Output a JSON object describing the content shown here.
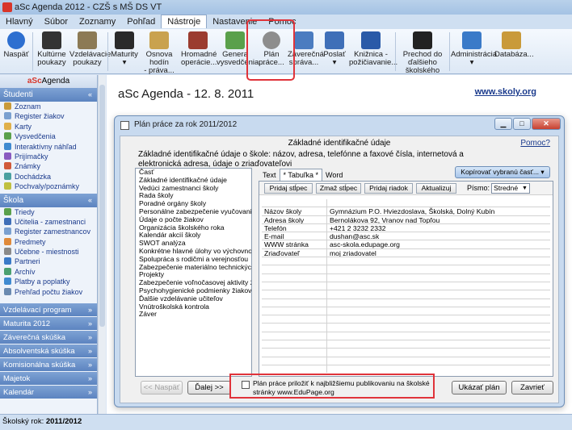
{
  "window": {
    "title": "aSc Agenda 2012 - CZŠ s MŠ DS VT"
  },
  "menu": {
    "items": [
      "Hlavný",
      "Súbor",
      "Zoznamy",
      "Pohľad",
      "Nástroje",
      "Nastavenie",
      "Pomoc"
    ],
    "active": "Nástroje"
  },
  "ribbon": {
    "buttons": [
      {
        "label1": "Naspäť",
        "label2": "",
        "icon": "back-arrow-icon",
        "color": "#2d6fd0"
      },
      {
        "label1": "Kultúrne",
        "label2": "poukazy",
        "icon": "piano-icon",
        "color": "#333333"
      },
      {
        "label1": "Vzdelávacie",
        "label2": "poukazy",
        "icon": "voucher-icon",
        "color": "#8c7a55"
      },
      {
        "label1": "Maturity",
        "label2": "",
        "icon": "graduation-icon",
        "color": "#2a2a2a"
      },
      {
        "label1": "Osnova hodín",
        "label2": "- práva...",
        "icon": "calendar-icon",
        "color": "#c9a24e"
      },
      {
        "label1": "Hromadné",
        "label2": "operácie...",
        "icon": "books-icon",
        "color": "#9b3c2f"
      },
      {
        "label1": "Genera",
        "label2": "vysvedčenia...",
        "icon": "certificate-icon",
        "color": "#5aa04b"
      },
      {
        "label1": "Plán",
        "label2": "práce...",
        "icon": "stopwatch-icon",
        "color": "#8d8d8d"
      },
      {
        "label1": "Záverečná",
        "label2": "správa...",
        "icon": "chart-icon",
        "color": "#4b7cc0"
      },
      {
        "label1": "Poslať",
        "label2": "",
        "icon": "people-icon",
        "color": "#3f6fb8"
      },
      {
        "label1": "Knižnica -",
        "label2": "požičiavanie...",
        "icon": "book-icon",
        "color": "#2a5aa8"
      },
      {
        "label1": "Prechod do",
        "label2": "ďalšieho",
        "label3": "školského roku...",
        "icon": "flag-icon",
        "color": "#222222"
      },
      {
        "label1": "Administrácia",
        "label2": "",
        "icon": "admin-icon",
        "color": "#3a7ac8"
      },
      {
        "label1": "Databáza...",
        "label2": "",
        "icon": "database-icon",
        "color": "#c99a3a"
      }
    ]
  },
  "sidebar": {
    "logo_a": "aSc",
    "logo_b": "Agenda",
    "studenti": {
      "title": "Študenti",
      "items": [
        "Zoznam",
        "Register žiakov",
        "Karty",
        "Vysvedčenia",
        "Interaktívny náhľad",
        "Prijímačky",
        "Známky",
        "Dochádzka",
        "Pochvaly/poznámky"
      ]
    },
    "skola": {
      "title": "Škola",
      "items": [
        "Triedy",
        "Učitelia - zamestnanci",
        "Register zamestnancov",
        "Predmety",
        "Učebne - miestnosti",
        "Partneri",
        "Archív",
        "Platby a poplatky",
        "Prehľad počtu žiakov"
      ]
    },
    "collapsed": [
      "Vzdelávací program",
      "Maturita 2012",
      "Záverečná skúška",
      "Absolventská skúška",
      "Komisionálna skúška",
      "Majetok",
      "Kalendár"
    ]
  },
  "main": {
    "heading": "aSc Agenda - 12. 8. 2011",
    "site_link": "www.skoly.org"
  },
  "status": {
    "label": "Školský rok:",
    "value": "2011/2012"
  },
  "dialog": {
    "title": "Plán práce za rok 2011/2012",
    "heading": "Základné identifikačné údaje",
    "help": "Pomoc?",
    "description": "Základné identifikačné údaje o škole: názov, adresa, telefónne a faxové čísla, internetová a elektronická adresa, údaje o zriaďovateľovi",
    "list_items": [
      "Časť",
      "Základné identifikačné údaje",
      "Vedúci zamestnanci školy",
      "Rada školy",
      "Poradné orgány školy",
      "Personálne zabezpečenie vyučovania",
      "Údaje o počte žiakov",
      "Organizácia školského roka",
      "Kalendár akcií školy",
      "SWOT analýza",
      "Konkrétne hlavné úlohy vo výchovno – vzde",
      "Spolupráca s rodičmi a verejnosťou",
      "Zabezpečenie materiálno technických podm",
      "Projekty",
      "Zabezpečenie voľnočasovej aktivity žiakov",
      "Psychohygienické podmienky žiakov a učite",
      "Ďalšie vzdelávanie učiteľov",
      "Vnútroškolská kontrola",
      "Záver"
    ],
    "tabs": [
      "Text",
      "* Tabuľka *",
      "Word"
    ],
    "copy_button": "Kopírovať vybranú časť...",
    "table_buttons": [
      "Pridaj stĺpec",
      "Zmaž stĺpec",
      "Pridaj riadok",
      "Aktualizuj"
    ],
    "font_label": "Písmo:",
    "font_value": "Stredné",
    "rows": [
      [
        "",
        ""
      ],
      [
        "Názov školy",
        "Gymnázium P.O. Hviezdoslava, Školská, Dolný Kubín"
      ],
      [
        "Adresa školy",
        "Bernolákova 92, Vranov nad Topľou"
      ],
      [
        "Telefón",
        "+421 2 3232 2332"
      ],
      [
        "E-mail",
        "dushan@asc.sk"
      ],
      [
        "WWW stránka",
        "asc-skola.edupage.org"
      ],
      [
        "Zriaďovateľ",
        "moj zriadovatel"
      ],
      [
        "",
        ""
      ],
      [
        "",
        ""
      ],
      [
        "",
        ""
      ],
      [
        "",
        ""
      ],
      [
        "",
        ""
      ],
      [
        "",
        ""
      ],
      [
        "",
        ""
      ],
      [
        "",
        ""
      ],
      [
        "",
        ""
      ],
      [
        "",
        ""
      ],
      [
        "",
        ""
      ],
      [
        "",
        ""
      ],
      [
        "",
        ""
      ]
    ],
    "prev_button": "<< Naspäť",
    "next_button": "Ďalej >>",
    "publish_checkbox": "Plán práce priložiť k najbližšiemu publikovaniu na školské stránky www.EduPage.org",
    "show_button": "Ukázať plán",
    "close_button": "Zavrieť"
  }
}
